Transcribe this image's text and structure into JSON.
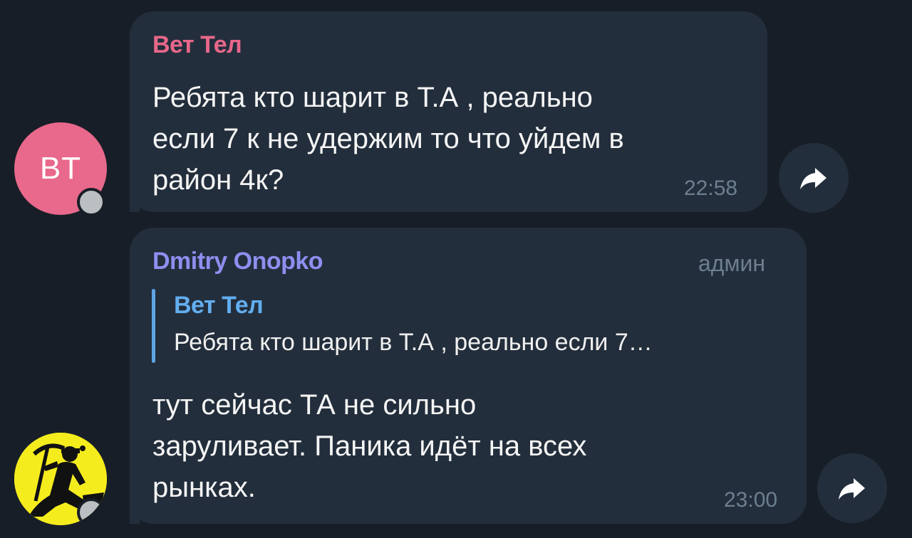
{
  "messages": [
    {
      "sender": "Вет Тел",
      "sender_color": "#e8678a",
      "avatar_initials": "BT",
      "avatar_color": "#e8698b",
      "text": "Ребята кто шарит в Т.А  , реально\nесли 7 к не удержим то что уйдем в\nрайон 4к?",
      "time": "22:58",
      "share_icon": "share-arrow-icon"
    },
    {
      "sender": "Dmitry Onopko",
      "sender_color": "#8d8ff0",
      "role": "админ",
      "avatar_icon": "miner-silhouette-icon",
      "avatar_color": "#f5ec1e",
      "reply": {
        "sender": "Вет Тел",
        "text": "Ребята кто шарит в Т.А  , реально если 7…",
        "bar_color": "#5ea5e6"
      },
      "text": "тут сейчас ТА не сильно\nзаруливает. Паника идёт на всех\nрынках.",
      "time": "23:00",
      "share_icon": "share-arrow-icon"
    }
  ],
  "theme": {
    "background": "#181e27",
    "bubble": "#232e3c",
    "time_color": "#6d7f8f",
    "status_dot": "#bcbfc2"
  }
}
